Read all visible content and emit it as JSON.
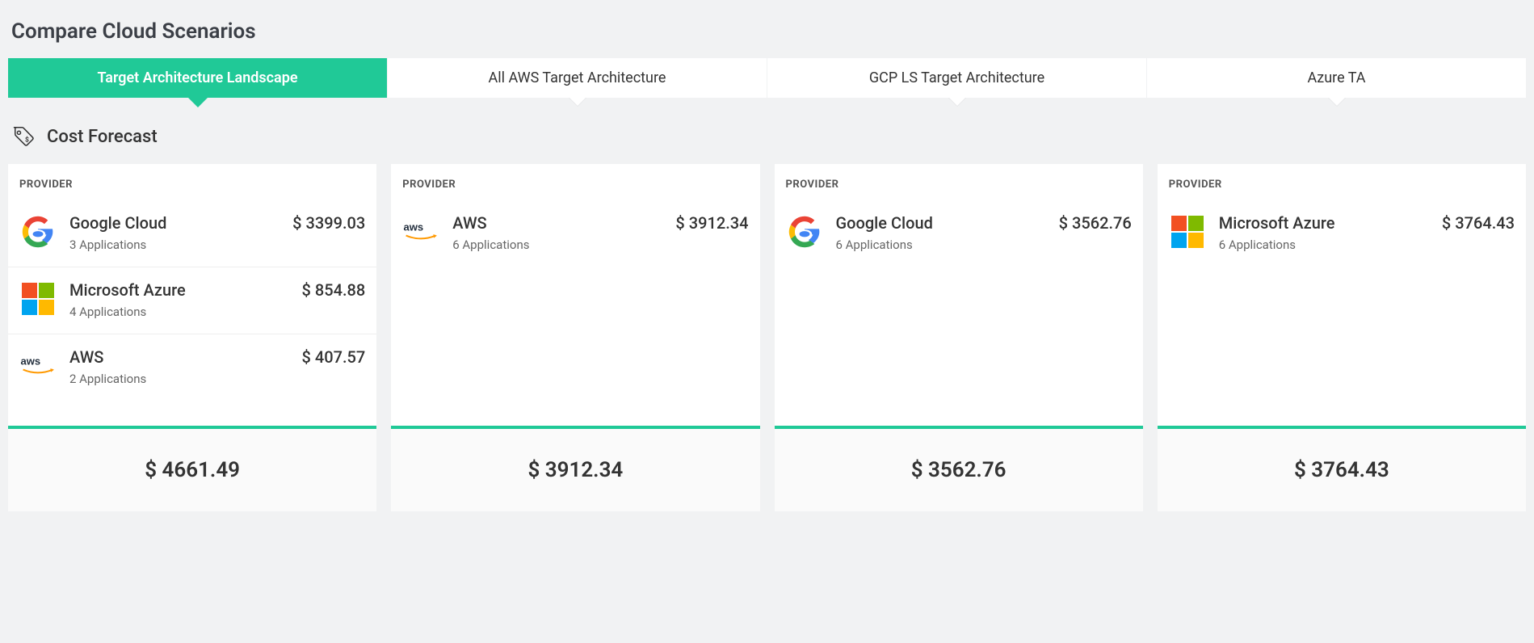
{
  "page_title": "Compare Cloud Scenarios",
  "tabs": [
    {
      "label": "Target Architecture Landscape",
      "active": true
    },
    {
      "label": "All AWS Target Architecture",
      "active": false
    },
    {
      "label": "GCP LS Target Architecture",
      "active": false
    },
    {
      "label": "Azure TA",
      "active": false
    }
  ],
  "section_title": "Cost Forecast",
  "column_header": "PROVIDER",
  "columns": [
    {
      "providers": [
        {
          "logo": "google",
          "name": "Google Cloud",
          "apps": "3 Applications",
          "cost": "$ 3399.03"
        },
        {
          "logo": "azure",
          "name": "Microsoft Azure",
          "apps": "4 Applications",
          "cost": "$ 854.88"
        },
        {
          "logo": "aws",
          "name": "AWS",
          "apps": "2 Applications",
          "cost": "$ 407.57"
        }
      ],
      "total": "$ 4661.49"
    },
    {
      "providers": [
        {
          "logo": "aws",
          "name": "AWS",
          "apps": "6 Applications",
          "cost": "$ 3912.34"
        }
      ],
      "total": "$ 3912.34"
    },
    {
      "providers": [
        {
          "logo": "google",
          "name": "Google Cloud",
          "apps": "6 Applications",
          "cost": "$ 3562.76"
        }
      ],
      "total": "$ 3562.76"
    },
    {
      "providers": [
        {
          "logo": "azure",
          "name": "Microsoft Azure",
          "apps": "6 Applications",
          "cost": "$ 3764.43"
        }
      ],
      "total": "$ 3764.43"
    }
  ]
}
